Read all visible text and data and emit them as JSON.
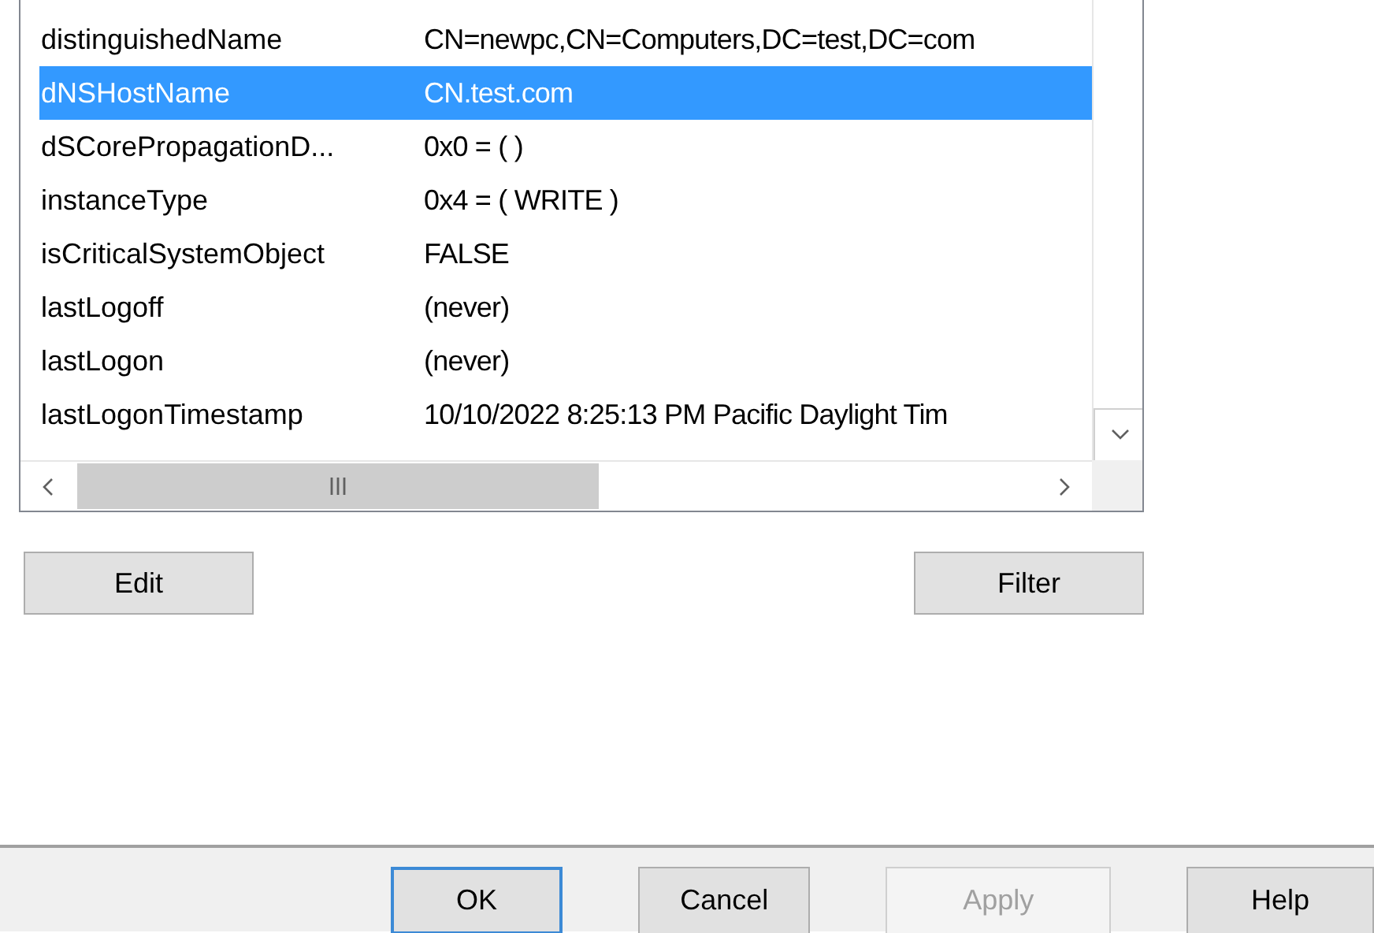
{
  "attributes": [
    {
      "name": "distinguishedName",
      "value": "CN=newpc,CN=Computers,DC=test,DC=com",
      "selected": false
    },
    {
      "name": "dNSHostName",
      "value": "CN.test.com",
      "selected": true
    },
    {
      "name": "dSCorePropagationD...",
      "value": "0x0 = (  )",
      "selected": false
    },
    {
      "name": "instanceType",
      "value": "0x4 = ( WRITE )",
      "selected": false
    },
    {
      "name": "isCriticalSystemObject",
      "value": "FALSE",
      "selected": false
    },
    {
      "name": "lastLogoff",
      "value": "(never)",
      "selected": false
    },
    {
      "name": "lastLogon",
      "value": "(never)",
      "selected": false
    },
    {
      "name": "lastLogonTimestamp",
      "value": "10/10/2022 8:25:13 PM Pacific Daylight Tim",
      "selected": false
    }
  ],
  "list_buttons": [
    "Edit",
    "Filter"
  ],
  "dialog_buttons": [
    {
      "label": "OK",
      "default": true,
      "disabled": false
    },
    {
      "label": "Cancel",
      "default": false,
      "disabled": false
    },
    {
      "label": "Apply",
      "default": false,
      "disabled": true
    },
    {
      "label": "Help",
      "default": false,
      "disabled": false
    }
  ]
}
